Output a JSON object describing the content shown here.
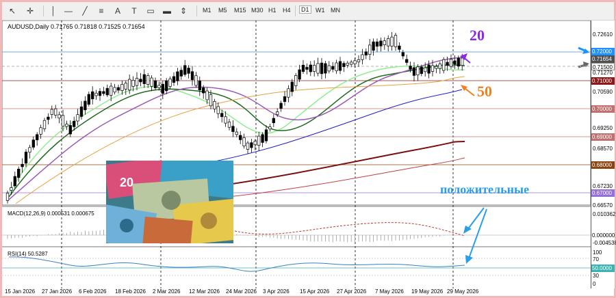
{
  "toolbar": {
    "icons": [
      "cursor-icon",
      "crosshair-icon",
      "horizontal-line-icon",
      "trendline-icon",
      "fibonacci-icon",
      "text-icon",
      "text-label-icon",
      "rectangle-icon",
      "objects-icon"
    ],
    "timeframes": [
      "M1",
      "M5",
      "M15",
      "M30",
      "H1",
      "H4",
      "D1",
      "W1",
      "MN"
    ],
    "active_timeframe": "D1"
  },
  "chart": {
    "ohlc_label": "AUDUSD,Daily  0.71765 0.71818 0.71525 0.71654",
    "price_labels": [
      "0.72610",
      "0.72000",
      "0.71654",
      "0.71500",
      "0.71270",
      "0.71000",
      "0.70590",
      "0.70000",
      "0.69250",
      "0.69000",
      "0.68570",
      "0.68000",
      "0.67230",
      "0.67000",
      "0.66570"
    ],
    "tagged_levels": [
      {
        "label": "0.72000",
        "color": "#1e90ff"
      },
      {
        "label": "0.71654",
        "color": "#505050"
      },
      {
        "label": "0.71500",
        "color": "#ffffff"
      },
      {
        "label": "0.71000",
        "color": "#8b1a1a"
      },
      {
        "label": "0.70000",
        "color": "#c07070"
      },
      {
        "label": "0.69000",
        "color": "#c07070"
      },
      {
        "label": "0.68000",
        "color": "#8b4513"
      },
      {
        "label": "0.67000",
        "color": "#9370db"
      }
    ],
    "x_labels": [
      "15 Jan 2026",
      "27 Jan 2026",
      "6 Feb 2026",
      "18 Feb 2026",
      "2 Mar 2026",
      "12 Mar 2026",
      "24 Mar 2026",
      "3 Apr 2026",
      "15 Apr 2026",
      "27 Apr 2026",
      "7 May 2026",
      "19 May 2026",
      "29 May 2026"
    ]
  },
  "macd": {
    "label": "MACD(12,26,9) 0.000531 0.000675",
    "labels": [
      "0.010362",
      "0.000000",
      "-0.004538"
    ]
  },
  "rsi": {
    "label": "RSI(14) 50.5287",
    "labels": [
      "100",
      "70",
      "50.0000",
      "30",
      "0"
    ]
  },
  "annotations": {
    "ma20": "20",
    "ma50": "50",
    "positive": "положительные"
  }
}
